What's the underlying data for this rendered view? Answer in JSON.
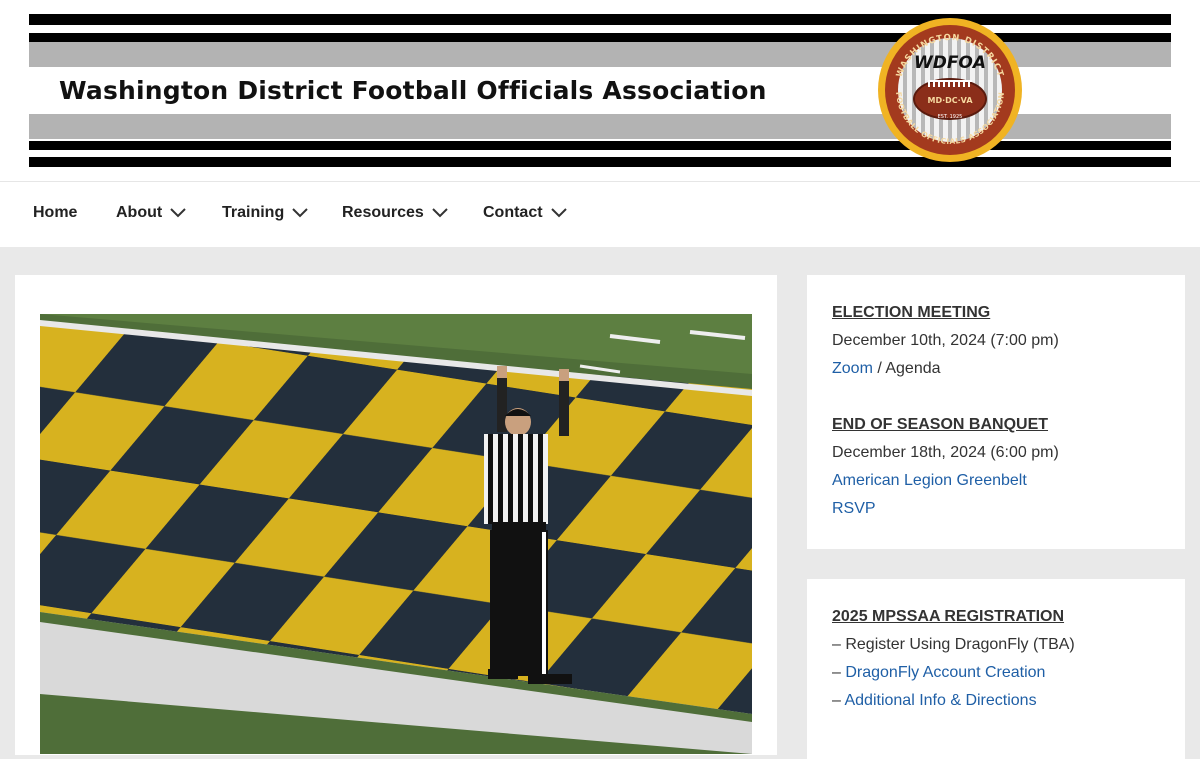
{
  "header": {
    "site_title": "Washington District Football Officials Association",
    "logo": {
      "abbr": "WDFOA",
      "arc_top": "WASHINGTON DISTRICT",
      "arc_bottom": "FOOTBALL OFFICIALS ASSOCIATION",
      "region": "MD·DC·VA",
      "established": "EST. 1925"
    }
  },
  "nav": {
    "items": [
      {
        "label": "Home",
        "has_dropdown": false
      },
      {
        "label": "About",
        "has_dropdown": true
      },
      {
        "label": "Training",
        "has_dropdown": true
      },
      {
        "label": "Resources",
        "has_dropdown": true
      },
      {
        "label": "Contact",
        "has_dropdown": true
      }
    ]
  },
  "sidebar": {
    "election": {
      "heading": "ELECTION MEETING",
      "date": "December 10th, 2024 (7:00 pm)",
      "zoom_link": "Zoom",
      "separator": " / ",
      "agenda": "Agenda"
    },
    "banquet": {
      "heading": "END OF SEASON BANQUET",
      "date": "December 18th, 2024 (6:00 pm)",
      "venue_link": "American Legion Greenbelt",
      "rsvp_link": "RSVP"
    },
    "registration": {
      "heading": "2025 MPSSAA REGISTRATION",
      "dash": "– ",
      "item1": "Register Using DragonFly (TBA)",
      "item2_link": "DragonFly Account Creation",
      "item3_link": "Additional Info & Directions"
    }
  },
  "colors": {
    "link": "#1f5fa6",
    "page_bg": "#e9e9e9",
    "logo_gold": "#f0b323",
    "logo_maroon": "#a33a1e",
    "field_yellow": "#d7b21f",
    "field_navy": "#232f3c"
  },
  "icons": {
    "nav_dropdown": "chevron-down-icon"
  }
}
